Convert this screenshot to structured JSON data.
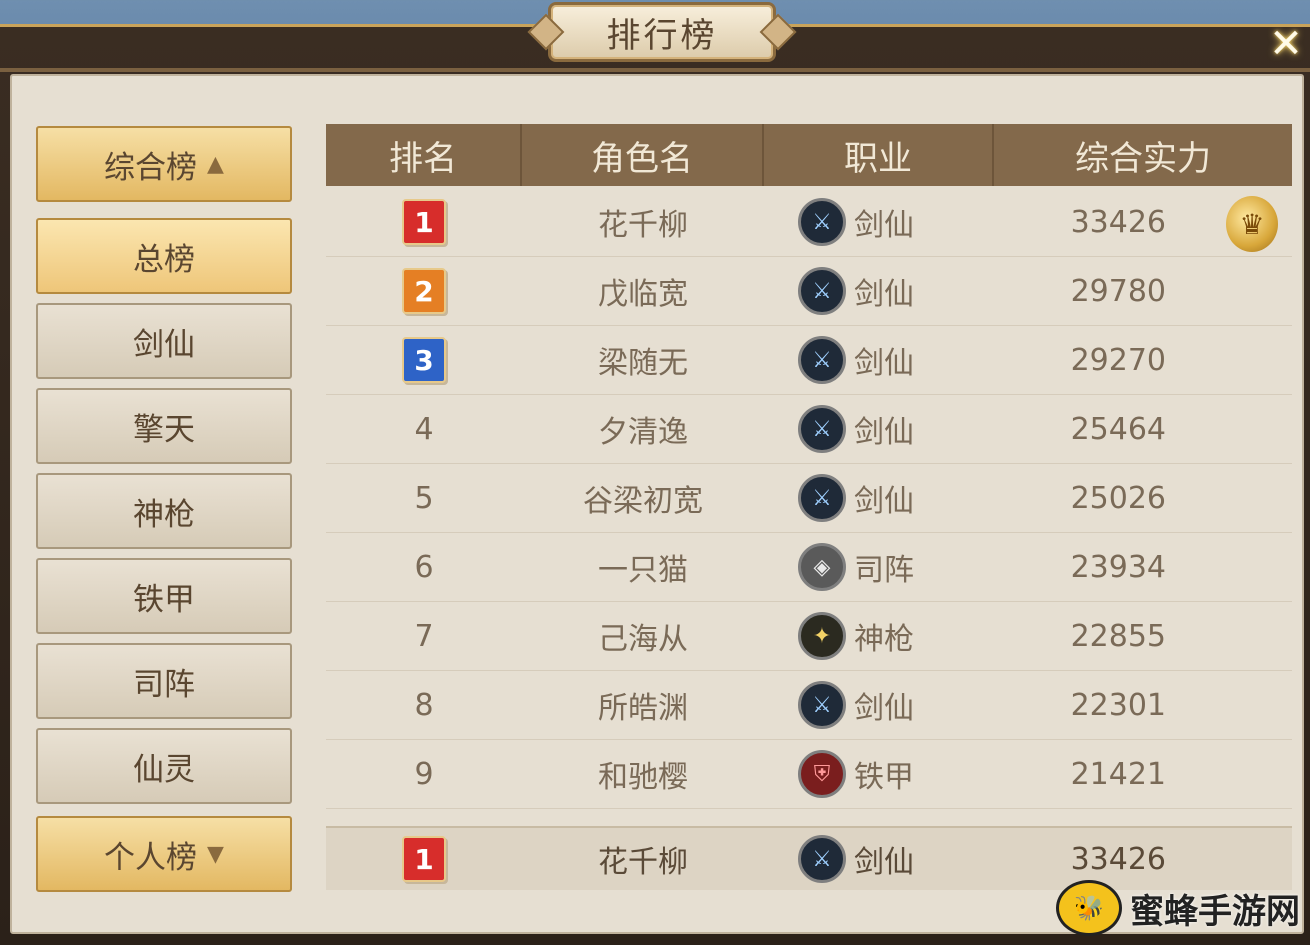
{
  "title": "排行榜",
  "close_label": "✕",
  "sidebar": {
    "groups": [
      {
        "label": "综合榜",
        "arrow": "▲",
        "expanded": true
      },
      {
        "label": "个人榜",
        "arrow": "▼",
        "expanded": false
      }
    ],
    "items": [
      {
        "label": "总榜",
        "active": true
      },
      {
        "label": "剑仙",
        "active": false
      },
      {
        "label": "擎天",
        "active": false
      },
      {
        "label": "神枪",
        "active": false
      },
      {
        "label": "铁甲",
        "active": false
      },
      {
        "label": "司阵",
        "active": false
      },
      {
        "label": "仙灵",
        "active": false
      }
    ]
  },
  "table": {
    "headers": [
      "排名",
      "角色名",
      "职业",
      "综合实力"
    ],
    "rows": [
      {
        "rank": "1",
        "name": "花千柳",
        "job": "剑仙",
        "job_icon": "sword-icon",
        "power": "33426"
      },
      {
        "rank": "2",
        "name": "戊临宽",
        "job": "剑仙",
        "job_icon": "sword-icon",
        "power": "29780"
      },
      {
        "rank": "3",
        "name": "梁随无",
        "job": "剑仙",
        "job_icon": "sword-icon",
        "power": "29270"
      },
      {
        "rank": "4",
        "name": "夕清逸",
        "job": "剑仙",
        "job_icon": "sword-icon",
        "power": "25464"
      },
      {
        "rank": "5",
        "name": "谷梁初宽",
        "job": "剑仙",
        "job_icon": "sword-icon",
        "power": "25026"
      },
      {
        "rank": "6",
        "name": "一只猫",
        "job": "司阵",
        "job_icon": "fan-icon",
        "power": "23934"
      },
      {
        "rank": "7",
        "name": "己海从",
        "job": "神枪",
        "job_icon": "spear-icon",
        "power": "22855"
      },
      {
        "rank": "8",
        "name": "所皓渊",
        "job": "剑仙",
        "job_icon": "sword-icon",
        "power": "22301"
      },
      {
        "rank": "9",
        "name": "和驰樱",
        "job": "铁甲",
        "job_icon": "armor-icon",
        "power": "21421"
      }
    ]
  },
  "my_rank": {
    "rank": "1",
    "name": "花千柳",
    "job": "剑仙",
    "job_icon": "sword-icon",
    "power": "33426"
  },
  "watermark": {
    "text": "蜜蜂手游网"
  },
  "colors": {
    "header_bg": "#83694b",
    "active_tab": "#eec679",
    "panel_bg": "#e6dfd2",
    "gold_medal": "#d72d2b",
    "silver_medal": "#e57f24",
    "bronze_medal": "#2e63c7"
  }
}
